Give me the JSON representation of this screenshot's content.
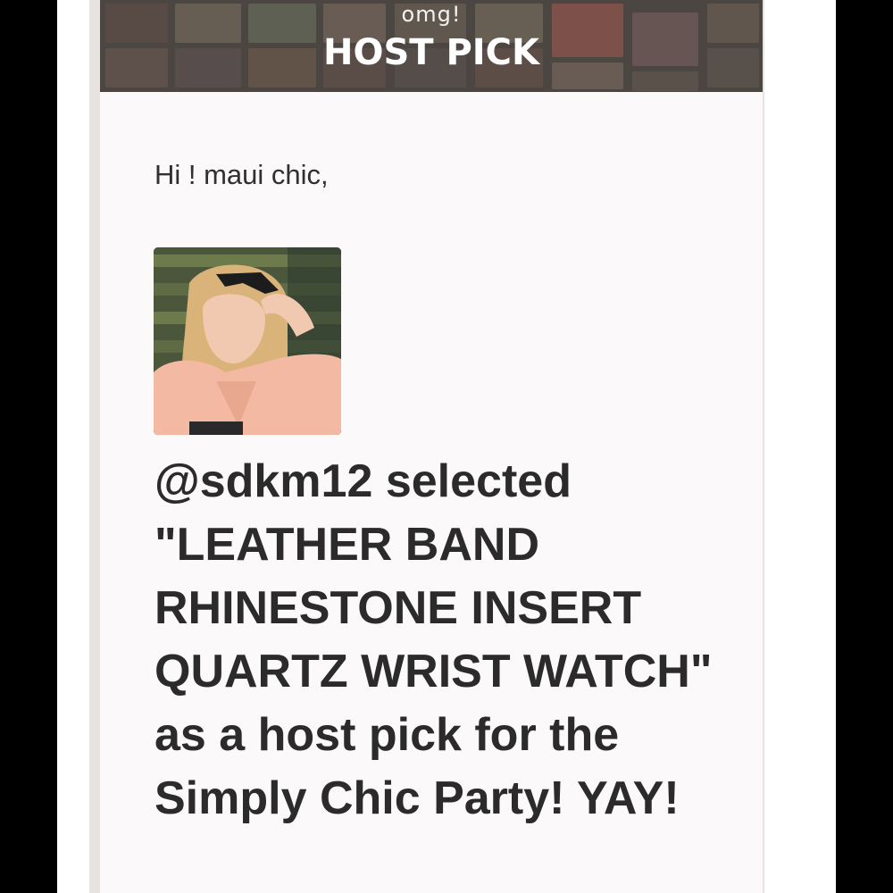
{
  "banner": {
    "kicker": "omg!",
    "title": "HOST PICK"
  },
  "email": {
    "greeting": "Hi ! maui chic,",
    "message": "@sdkm12 selected \"LEATHER BAND RHINESTONE INSERT QUARTZ WRIST WATCH\" as a host pick for the Simply Chic Party! YAY!"
  },
  "host_photo": {
    "icon": "host-avatar-photo"
  },
  "colors": {
    "page_background": "#000000",
    "card_background": "#fbf9f9",
    "banner_background": "#5a5350",
    "text": "#2b2b2b"
  }
}
